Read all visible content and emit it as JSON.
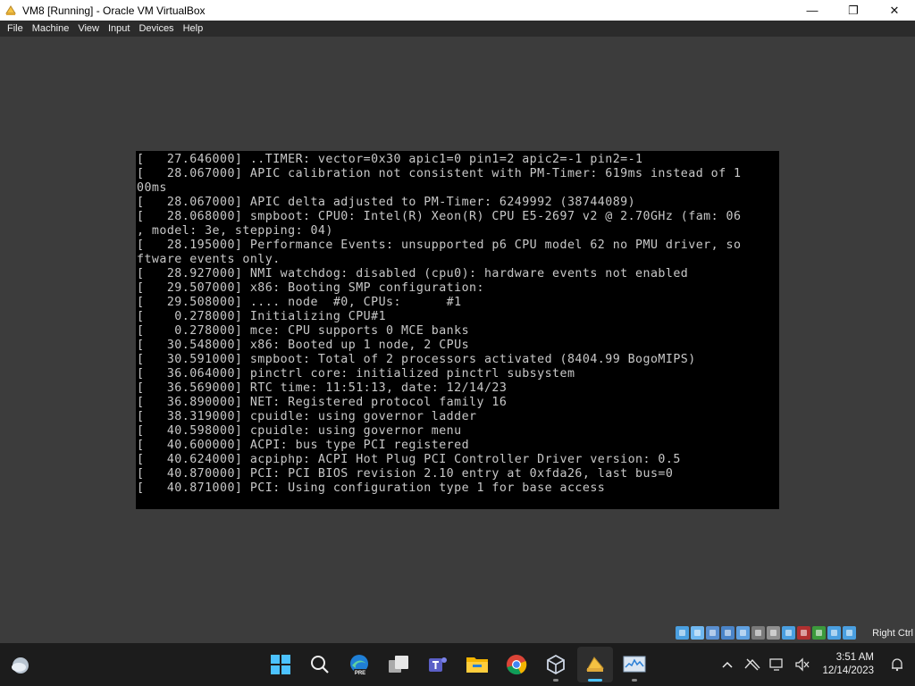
{
  "window": {
    "title": "VM8 [Running] - Oracle VM VirtualBox",
    "minimize_symbol": "—",
    "maximize_symbol": "❐",
    "close_symbol": "✕"
  },
  "menu": [
    {
      "label": "File"
    },
    {
      "label": "Machine"
    },
    {
      "label": "View"
    },
    {
      "label": "Input"
    },
    {
      "label": "Devices"
    },
    {
      "label": "Help"
    }
  ],
  "console": {
    "lines": [
      "[   27.646000] ..TIMER: vector=0x30 apic1=0 pin1=2 apic2=-1 pin2=-1",
      "[   28.067000] APIC calibration not consistent with PM-Timer: 619ms instead of 1",
      "00ms",
      "[   28.067000] APIC delta adjusted to PM-Timer: 6249992 (38744089)",
      "[   28.068000] smpboot: CPU0: Intel(R) Xeon(R) CPU E5-2697 v2 @ 2.70GHz (fam: 06",
      ", model: 3e, stepping: 04)",
      "[   28.195000] Performance Events: unsupported p6 CPU model 62 no PMU driver, so",
      "ftware events only.",
      "[   28.927000] NMI watchdog: disabled (cpu0): hardware events not enabled",
      "[   29.507000] x86: Booting SMP configuration:",
      "[   29.508000] .... node  #0, CPUs:      #1",
      "[    0.278000] Initializing CPU#1",
      "[    0.278000] mce: CPU supports 0 MCE banks",
      "[   30.548000] x86: Booted up 1 node, 2 CPUs",
      "[   30.591000] smpboot: Total of 2 processors activated (8404.99 BogoMIPS)",
      "[   36.064000] pinctrl core: initialized pinctrl subsystem",
      "[   36.569000] RTC time: 11:51:13, date: 12/14/23",
      "[   36.890000] NET: Registered protocol family 16",
      "[   38.319000] cpuidle: using governor ladder",
      "[   40.598000] cpuidle: using governor menu",
      "[   40.600000] ACPI: bus type PCI registered",
      "[   40.624000] acpiphp: ACPI Hot Plug PCI Controller Driver version: 0.5",
      "[   40.870000] PCI: PCI BIOS revision 2.10 entry at 0xfda26, last bus=0",
      "[   40.871000] PCI: Using configuration type 1 for base access"
    ]
  },
  "statusbar": {
    "icons": [
      {
        "name": "hard-disk-icon",
        "color": "#4a9fe0"
      },
      {
        "name": "optical-drive-icon",
        "color": "#6fb7f0"
      },
      {
        "name": "audio-icon",
        "color": "#5a8fd0"
      },
      {
        "name": "network-icon",
        "color": "#4a84c8"
      },
      {
        "name": "usb-icon",
        "color": "#5fa0e0"
      },
      {
        "name": "shared-folders-icon",
        "color": "#7a7a7a"
      },
      {
        "name": "display-icon",
        "color": "#909090"
      },
      {
        "name": "video-capture-icon",
        "color": "#4a9fe0"
      },
      {
        "name": "recording-icon",
        "color": "#b03030"
      },
      {
        "name": "cpu-icon",
        "color": "#3c9a3c"
      },
      {
        "name": "mouse-integration-icon",
        "color": "#4a9fe0"
      },
      {
        "name": "keyboard-capture-icon",
        "color": "#4a9fe0"
      }
    ],
    "host_key": "Right Ctrl"
  },
  "taskbar": {
    "apps": [
      {
        "name": "start-button",
        "active": false
      },
      {
        "name": "search-button",
        "active": false
      },
      {
        "name": "edge-preview-button",
        "active": false,
        "badge": "PRE"
      },
      {
        "name": "task-view-button",
        "active": false
      },
      {
        "name": "teams-button",
        "active": false
      },
      {
        "name": "file-explorer-button",
        "active": false
      },
      {
        "name": "chrome-button",
        "active": false
      },
      {
        "name": "virtualbox-manager-button",
        "active": false
      },
      {
        "name": "virtualbox-vm-button",
        "active": true
      },
      {
        "name": "resource-monitor-button",
        "active": false
      }
    ],
    "clock": {
      "time": "3:51 AM",
      "date": "12/14/2023"
    }
  }
}
